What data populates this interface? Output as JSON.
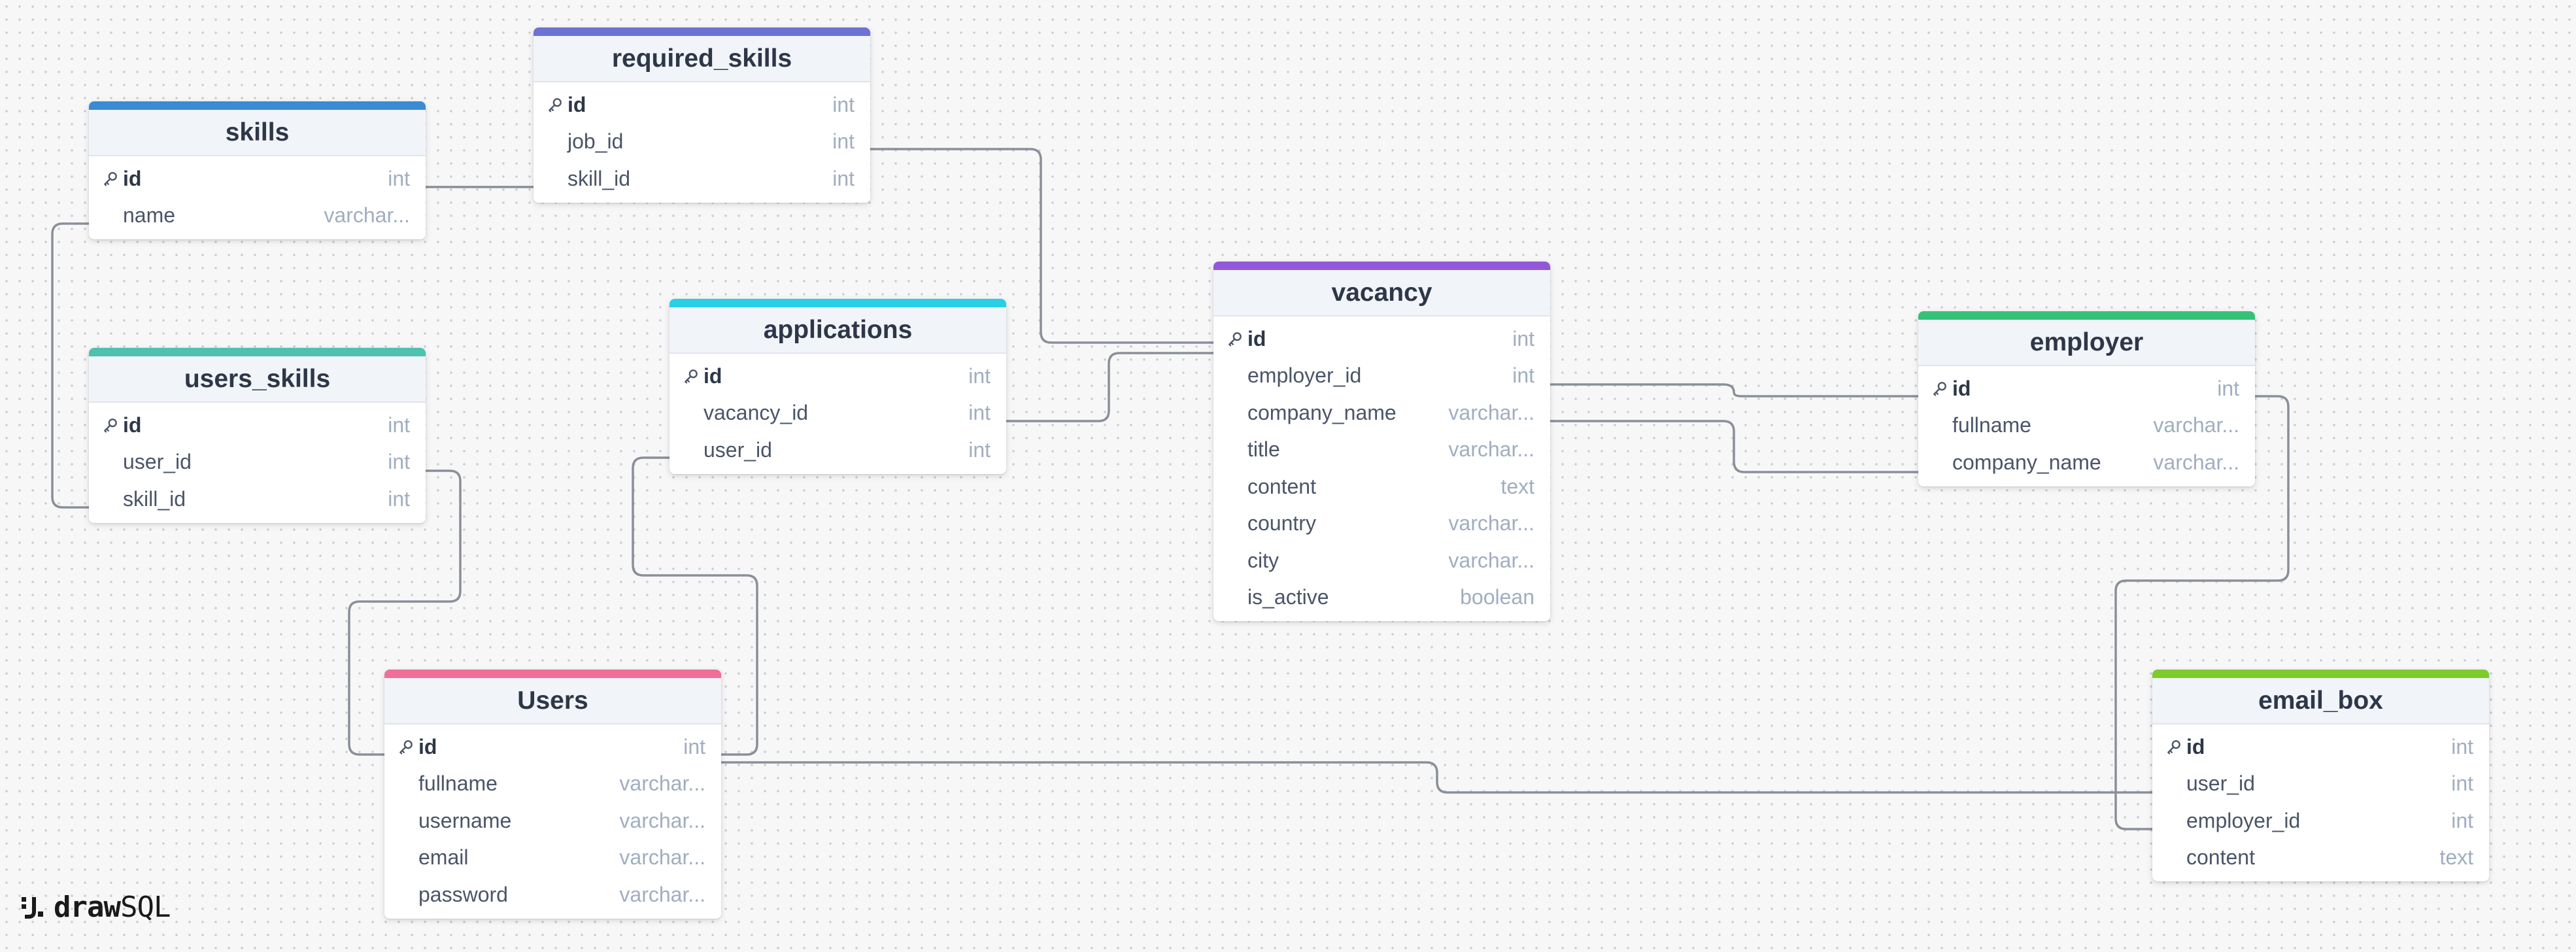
{
  "brand": {
    "name_bold": "draw",
    "name_rest": "SQL",
    "icon": "drawsql-logo-icon"
  },
  "icons": {
    "primary_key": "key-icon"
  },
  "tables": {
    "required_skills": {
      "title": "required_skills",
      "accent": "#6b73d4",
      "columns": [
        {
          "name": "id",
          "type": "int",
          "pk": true
        },
        {
          "name": "job_id",
          "type": "int",
          "pk": false
        },
        {
          "name": "skill_id",
          "type": "int",
          "pk": false
        }
      ]
    },
    "skills": {
      "title": "skills",
      "accent": "#3a8bd4",
      "columns": [
        {
          "name": "id",
          "type": "int",
          "pk": true
        },
        {
          "name": "name",
          "type": "varchar...",
          "pk": false
        }
      ]
    },
    "users_skills": {
      "title": "users_skills",
      "accent": "#4fc1b0",
      "columns": [
        {
          "name": "id",
          "type": "int",
          "pk": true
        },
        {
          "name": "user_id",
          "type": "int",
          "pk": false
        },
        {
          "name": "skill_id",
          "type": "int",
          "pk": false
        }
      ]
    },
    "applications": {
      "title": "applications",
      "accent": "#27d0e5",
      "columns": [
        {
          "name": "id",
          "type": "int",
          "pk": true
        },
        {
          "name": "vacancy_id",
          "type": "int",
          "pk": false
        },
        {
          "name": "user_id",
          "type": "int",
          "pk": false
        }
      ]
    },
    "vacancy": {
      "title": "vacancy",
      "accent": "#9159d9",
      "columns": [
        {
          "name": "id",
          "type": "int",
          "pk": true
        },
        {
          "name": "employer_id",
          "type": "int",
          "pk": false
        },
        {
          "name": "company_name",
          "type": "varchar...",
          "pk": false
        },
        {
          "name": "title",
          "type": "varchar...",
          "pk": false
        },
        {
          "name": "content",
          "type": "text",
          "pk": false
        },
        {
          "name": "country",
          "type": "varchar...",
          "pk": false
        },
        {
          "name": "city",
          "type": "varchar...",
          "pk": false
        },
        {
          "name": "is_active",
          "type": "boolean",
          "pk": false
        }
      ]
    },
    "employer": {
      "title": "employer",
      "accent": "#35c178",
      "columns": [
        {
          "name": "id",
          "type": "int",
          "pk": true
        },
        {
          "name": "fullname",
          "type": "varchar...",
          "pk": false
        },
        {
          "name": "company_name",
          "type": "varchar...",
          "pk": false
        }
      ]
    },
    "users": {
      "title": "Users",
      "accent": "#f06f96",
      "columns": [
        {
          "name": "id",
          "type": "int",
          "pk": true
        },
        {
          "name": "fullname",
          "type": "varchar...",
          "pk": false
        },
        {
          "name": "username",
          "type": "varchar...",
          "pk": false
        },
        {
          "name": "email",
          "type": "varchar...",
          "pk": false
        },
        {
          "name": "password",
          "type": "varchar...",
          "pk": false
        }
      ]
    },
    "email_box": {
      "title": "email_box",
      "accent": "#7ecb2c",
      "columns": [
        {
          "name": "id",
          "type": "int",
          "pk": true
        },
        {
          "name": "user_id",
          "type": "int",
          "pk": false
        },
        {
          "name": "employer_id",
          "type": "int",
          "pk": false
        },
        {
          "name": "content",
          "type": "text",
          "pk": false
        }
      ]
    }
  },
  "relations": [
    {
      "from": "skills.id",
      "to": "required_skills.skill_id"
    },
    {
      "from": "skills.id",
      "to": "users_skills.skill_id"
    },
    {
      "from": "users.id",
      "to": "users_skills.user_id"
    },
    {
      "from": "users.id",
      "to": "applications.user_id"
    },
    {
      "from": "vacancy.id",
      "to": "applications.vacancy_id"
    },
    {
      "from": "vacancy.id",
      "to": "required_skills.job_id"
    },
    {
      "from": "employer.id",
      "to": "vacancy.employer_id"
    },
    {
      "from": "employer.company_name",
      "to": "vacancy.company_name"
    },
    {
      "from": "employer.id",
      "to": "email_box.employer_id"
    },
    {
      "from": "users.id",
      "to": "email_box.user_id"
    }
  ]
}
